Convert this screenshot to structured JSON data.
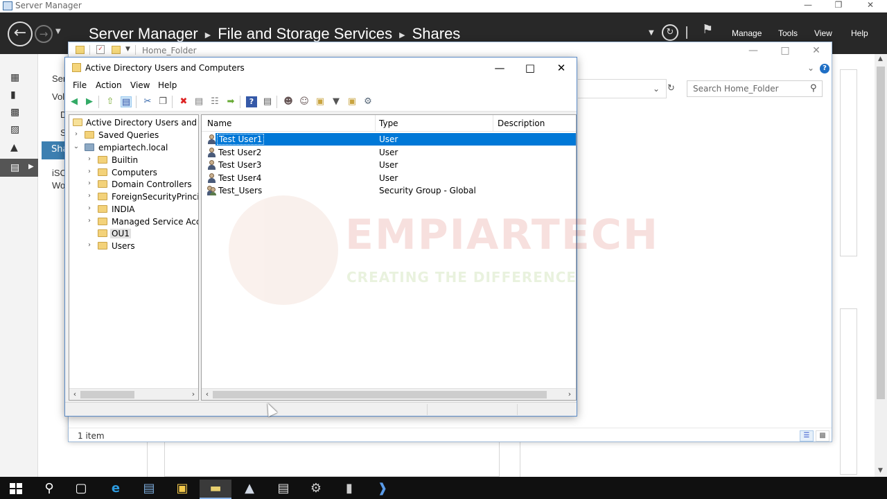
{
  "server_manager": {
    "window_title": "Server Manager",
    "window_controls": [
      "—",
      "❐",
      "✕"
    ],
    "breadcrumb": [
      "Server Manager",
      "File and Storage Services",
      "Shares"
    ],
    "header_menu": [
      "Manage",
      "Tools",
      "View",
      "Help"
    ],
    "subnav_items": [
      "Ser",
      "Vol",
      "D",
      "S",
      "Sha",
      "iSC",
      "Wo"
    ]
  },
  "explorer": {
    "title": "Home_Folder",
    "search_placeholder": "Search Home_Folder",
    "status": "1 item"
  },
  "aduc": {
    "title": "Active Directory Users and Computers",
    "menu": [
      "File",
      "Action",
      "View",
      "Help"
    ],
    "tree": {
      "root": "Active Directory Users and Com",
      "saved_queries": "Saved Queries",
      "domain": "empiartech.local",
      "children": [
        "Builtin",
        "Computers",
        "Domain Controllers",
        "ForeignSecurityPrincipals",
        "INDIA",
        "Managed Service Accour",
        "OU1",
        "Users"
      ]
    },
    "columns": [
      "Name",
      "Type",
      "Description"
    ],
    "rows": [
      {
        "name": "Test User1",
        "type": "User",
        "description": ""
      },
      {
        "name": "Test User2",
        "type": "User",
        "description": ""
      },
      {
        "name": "Test User3",
        "type": "User",
        "description": ""
      },
      {
        "name": "Test User4",
        "type": "User",
        "description": ""
      },
      {
        "name": "Test_Users",
        "type": "Security Group - Global",
        "description": ""
      }
    ]
  },
  "watermark": {
    "brand": "EMPIARTECH",
    "tagline": "CREATING THE DIFFERENCE"
  },
  "colors": {
    "selection": "#0078d7",
    "header_bg": "#282828",
    "taskbar_bg": "#101010"
  }
}
